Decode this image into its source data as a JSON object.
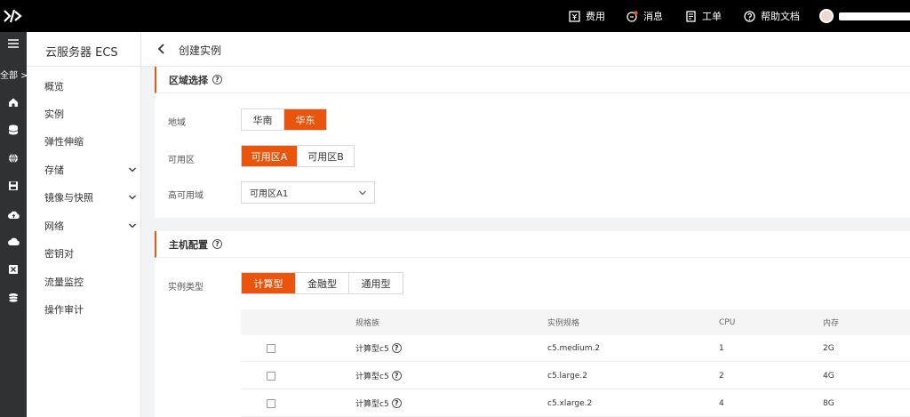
{
  "topbar": {
    "items": [
      {
        "label": "费用",
        "icon": "billing-icon"
      },
      {
        "label": "消息",
        "icon": "message-icon"
      },
      {
        "label": "工单",
        "icon": "ticket-icon"
      },
      {
        "label": "帮助文档",
        "icon": "help-icon"
      }
    ]
  },
  "rail": {
    "all_label": "全部 >",
    "icons": [
      "home-icon",
      "database-icon",
      "globe-icon",
      "save-icon",
      "cloud-upload-icon",
      "cloud-icon",
      "close-box-icon",
      "stack-icon"
    ]
  },
  "sidebar": {
    "title": "云服务器 ECS",
    "items": [
      {
        "label": "概览",
        "expandable": false
      },
      {
        "label": "实例",
        "expandable": false
      },
      {
        "label": "弹性伸缩",
        "expandable": false
      },
      {
        "label": "存储",
        "expandable": true
      },
      {
        "label": "镜像与快照",
        "expandable": true
      },
      {
        "label": "网络",
        "expandable": true
      },
      {
        "label": "密钥对",
        "expandable": false
      },
      {
        "label": "流量监控",
        "expandable": false
      },
      {
        "label": "操作审计",
        "expandable": false
      }
    ]
  },
  "page": {
    "title": "创建实例"
  },
  "region_card": {
    "title": "区域选择",
    "region_label": "地域",
    "region_options": [
      "华南",
      "华东"
    ],
    "region_selected": "华东",
    "zone_label": "可用区",
    "zone_options": [
      "可用区A",
      "可用区B"
    ],
    "zone_selected": "可用区A",
    "ha_label": "高可用域",
    "ha_value": "可用区A1"
  },
  "host_card": {
    "title": "主机配置",
    "type_label": "实例类型",
    "type_options": [
      "计算型",
      "金融型",
      "通用型"
    ],
    "type_selected": "计算型",
    "table": {
      "headers": [
        "",
        "规格族",
        "实例规格",
        "CPU",
        "内存"
      ],
      "rows": [
        {
          "family": "计算型c5",
          "spec": "c5.medium.2",
          "cpu": "1",
          "memory": "2G"
        },
        {
          "family": "计算型c5",
          "spec": "c5.large.2",
          "cpu": "2",
          "memory": "4G"
        },
        {
          "family": "计算型c5",
          "spec": "c5.xlarge.2",
          "cpu": "4",
          "memory": "8G"
        }
      ]
    }
  },
  "colors": {
    "accent": "#e9550c",
    "topbar_bg": "#000000",
    "rail_bg": "#2f3133"
  }
}
